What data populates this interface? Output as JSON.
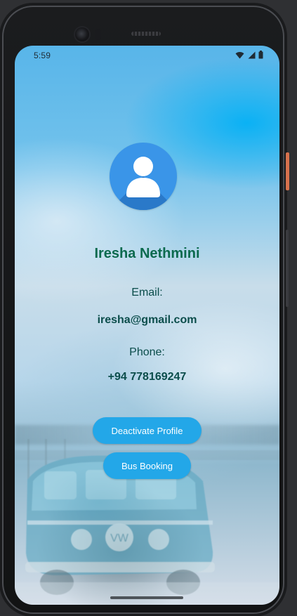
{
  "status_bar": {
    "time": "5:59",
    "icons": [
      "wifi-icon",
      "signal-icon",
      "battery-icon"
    ]
  },
  "profile": {
    "avatar_icon": "user-avatar-icon",
    "name": "Iresha Nethmini",
    "email_label": "Email:",
    "email": "iresha@gmail.com",
    "phone_label": "Phone:",
    "phone": "+94 778169247"
  },
  "actions": {
    "deactivate_label": "Deactivate Profile",
    "bus_booking_label": "Bus Booking"
  },
  "colors": {
    "accent": "#23a7e8",
    "name_text": "#0b6a4e",
    "body_text": "#0b4d4b",
    "avatar": "#3a95e8"
  }
}
